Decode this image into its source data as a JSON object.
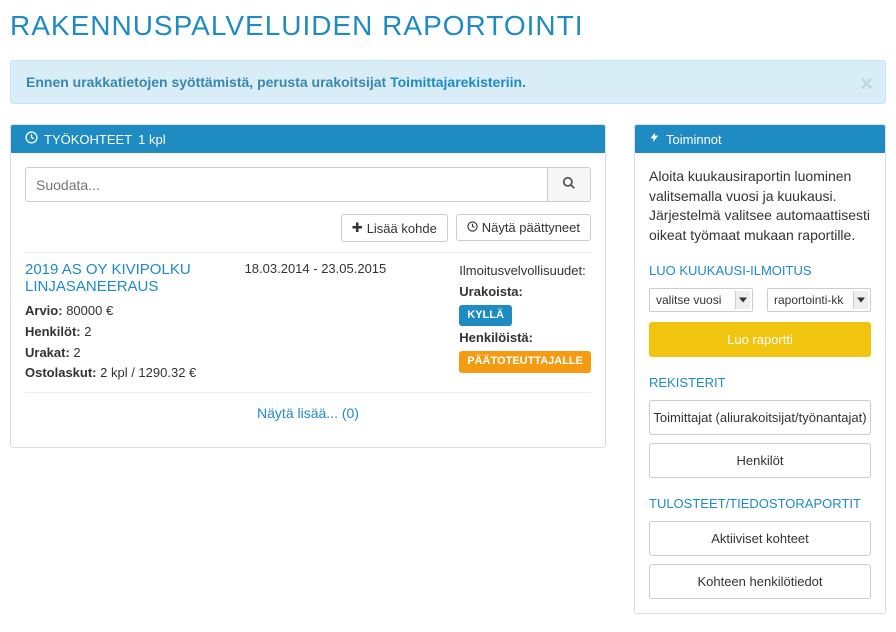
{
  "page_title": "RAKENNUSPALVELUIDEN RAPORTOINTI",
  "alert": {
    "text_before": "Ennen urakkatietojen syöttämistä, perusta urakoitsijat ",
    "link_text": "Toimittajarekisteriin.",
    "close": "×"
  },
  "left": {
    "panel_title_prefix": "TYÖKOHTEET",
    "panel_title_count": "1 kpl",
    "search_placeholder": "Suodata...",
    "btn_add": "Lisää kohde",
    "btn_show_ended": "Näytä päättyneet",
    "project": {
      "title": "2019 AS OY KIVIPOLKU LINJASANEERAUS",
      "arvio_label": "Arvio:",
      "arvio_value": "80000 €",
      "henkilot_label": "Henkilöt:",
      "henkilot_value": "2",
      "urakat_label": "Urakat:",
      "urakat_value": "2",
      "ostolaskut_label": "Ostolaskut:",
      "ostolaskut_value": "2 kpl / 1290.32 €",
      "dates": "18.03.2014 - 23.05.2015",
      "ilm_label": "Ilmoitusvelvollisuudet:",
      "urakoista_label": "Urakoista:",
      "urakoista_badge": "KYLLÄ",
      "henkiloista_label": "Henkilöistä:",
      "henkiloista_badge": "PÄÄTOTEUTTAJALLE"
    },
    "show_more": "Näytä lisää... (0)"
  },
  "right": {
    "panel_title": "Toiminnot",
    "info": "Aloita kuukausiraportin luominen valitsemalla vuosi ja kuukausi. Järjestelmä valitsee automaattisesti oikeat työmaat mukaan raportille.",
    "section_month": "LUO KUUKAUSI-ILMOITUS",
    "select_year": "valitse vuosi",
    "select_month": "raportointi-kk",
    "btn_create": "Luo raportti",
    "section_registers": "REKISTERIT",
    "btn_suppliers": "Toimittajat (aliurakoitsijat/työnantajat)",
    "btn_persons": "Henkilöt",
    "section_reports": "TULOSTEET/TIEDOSTORAPORTIT",
    "btn_active": "Aktiiviset kohteet",
    "btn_person_info": "Kohteen henkilötiedot"
  }
}
